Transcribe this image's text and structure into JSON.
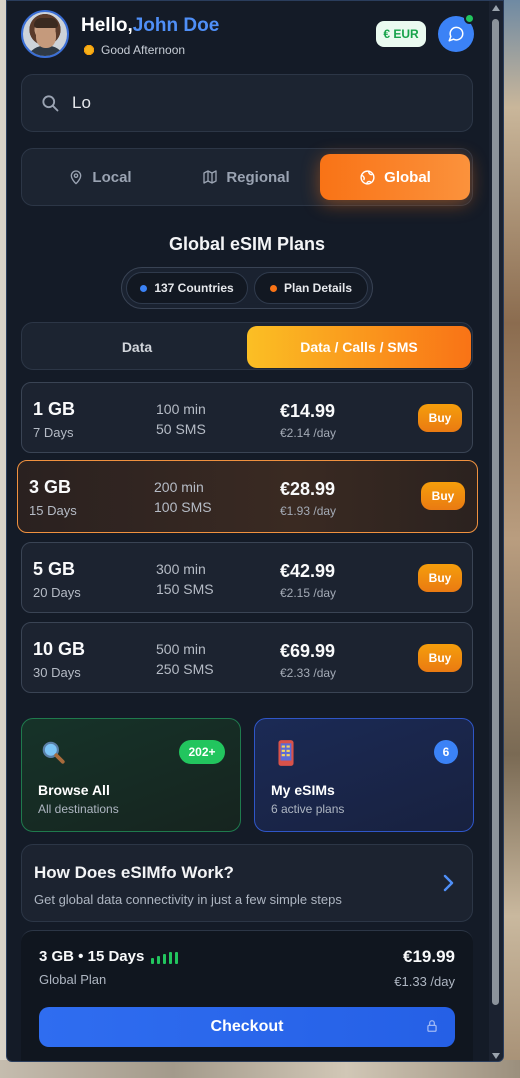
{
  "header": {
    "greeting": "Hello,",
    "user_name": "John Doe",
    "subgreeting": "Good Afternoon",
    "currency": "€ EUR"
  },
  "search": {
    "value": "Lo"
  },
  "region_tabs": [
    {
      "label": "Local",
      "icon": "map-pin-icon",
      "active": false
    },
    {
      "label": "Regional",
      "icon": "map-icon",
      "active": false
    },
    {
      "label": "Global",
      "icon": "globe-icon",
      "active": true
    }
  ],
  "section": {
    "title": "Global eSIM Plans",
    "countries_chip": "137 Countries",
    "details_chip": "Plan Details"
  },
  "plan_types": [
    {
      "label": "Data",
      "active": false
    },
    {
      "label": "Data / Calls / SMS",
      "active": true
    }
  ],
  "plans": [
    {
      "gb": "1 GB",
      "days": "7 Days",
      "minutes": "100 min",
      "sms": "50 SMS",
      "price": "€14.99",
      "per_day": "€2.14 /day",
      "buy": "Buy",
      "selected": false
    },
    {
      "gb": "3 GB",
      "days": "15 Days",
      "minutes": "200 min",
      "sms": "100 SMS",
      "price": "€28.99",
      "per_day": "€1.93 /day",
      "buy": "Buy",
      "selected": true
    },
    {
      "gb": "5 GB",
      "days": "20 Days",
      "minutes": "300 min",
      "sms": "150 SMS",
      "price": "€42.99",
      "per_day": "€2.15 /day",
      "buy": "Buy",
      "selected": false
    },
    {
      "gb": "10 GB",
      "days": "30 Days",
      "minutes": "500 min",
      "sms": "250 SMS",
      "price": "€69.99",
      "per_day": "€2.33 /day",
      "buy": "Buy",
      "selected": false
    }
  ],
  "cards": {
    "browse": {
      "title": "Browse All",
      "desc": "All destinations",
      "badge": "202+",
      "icon": "magnifier-icon"
    },
    "esims": {
      "title": "My eSIMs",
      "desc": "6 active plans",
      "badge": "6",
      "icon": "phone-icon"
    }
  },
  "how": {
    "title": "How Does eSIMfo Work?",
    "desc": "Get global data connectivity in just a few simple steps"
  },
  "footer": {
    "plan": "3 GB • 15 Days",
    "type": "Global Plan",
    "price": "€19.99",
    "per_day": "€1.33 /day",
    "checkout": "Checkout"
  },
  "colors": {
    "accent_orange": "#f97316",
    "accent_blue": "#3b82f6",
    "online_green": "#22c55e",
    "background": "#141b27"
  }
}
